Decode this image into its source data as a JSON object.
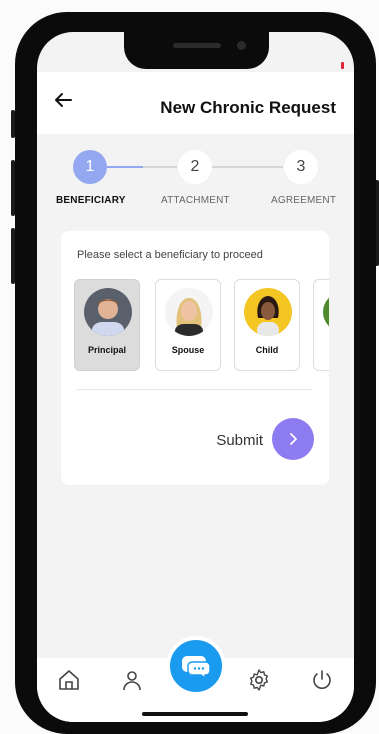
{
  "header": {
    "title": "New Chronic Request",
    "back_icon": "arrow-left-icon"
  },
  "stepper": {
    "steps": [
      {
        "number": "1",
        "label": "BENEFICIARY",
        "active": true
      },
      {
        "number": "2",
        "label": "ATTACHMENT",
        "active": false
      },
      {
        "number": "3",
        "label": "AGREEMENT",
        "active": false
      }
    ],
    "active_color": "#93a8f0"
  },
  "card": {
    "prompt": "Please select a beneficiary to proceed",
    "beneficiaries": [
      {
        "label": "Principal",
        "selected": true
      },
      {
        "label": "Spouse",
        "selected": false
      },
      {
        "label": "Child",
        "selected": false
      }
    ],
    "submit_label": "Submit",
    "submit_color": "#8d7bf2"
  },
  "nav": {
    "items": [
      "home-icon",
      "profile-icon",
      "chat-icon",
      "settings-icon",
      "power-icon"
    ],
    "fab_color": "#1a9bef"
  }
}
